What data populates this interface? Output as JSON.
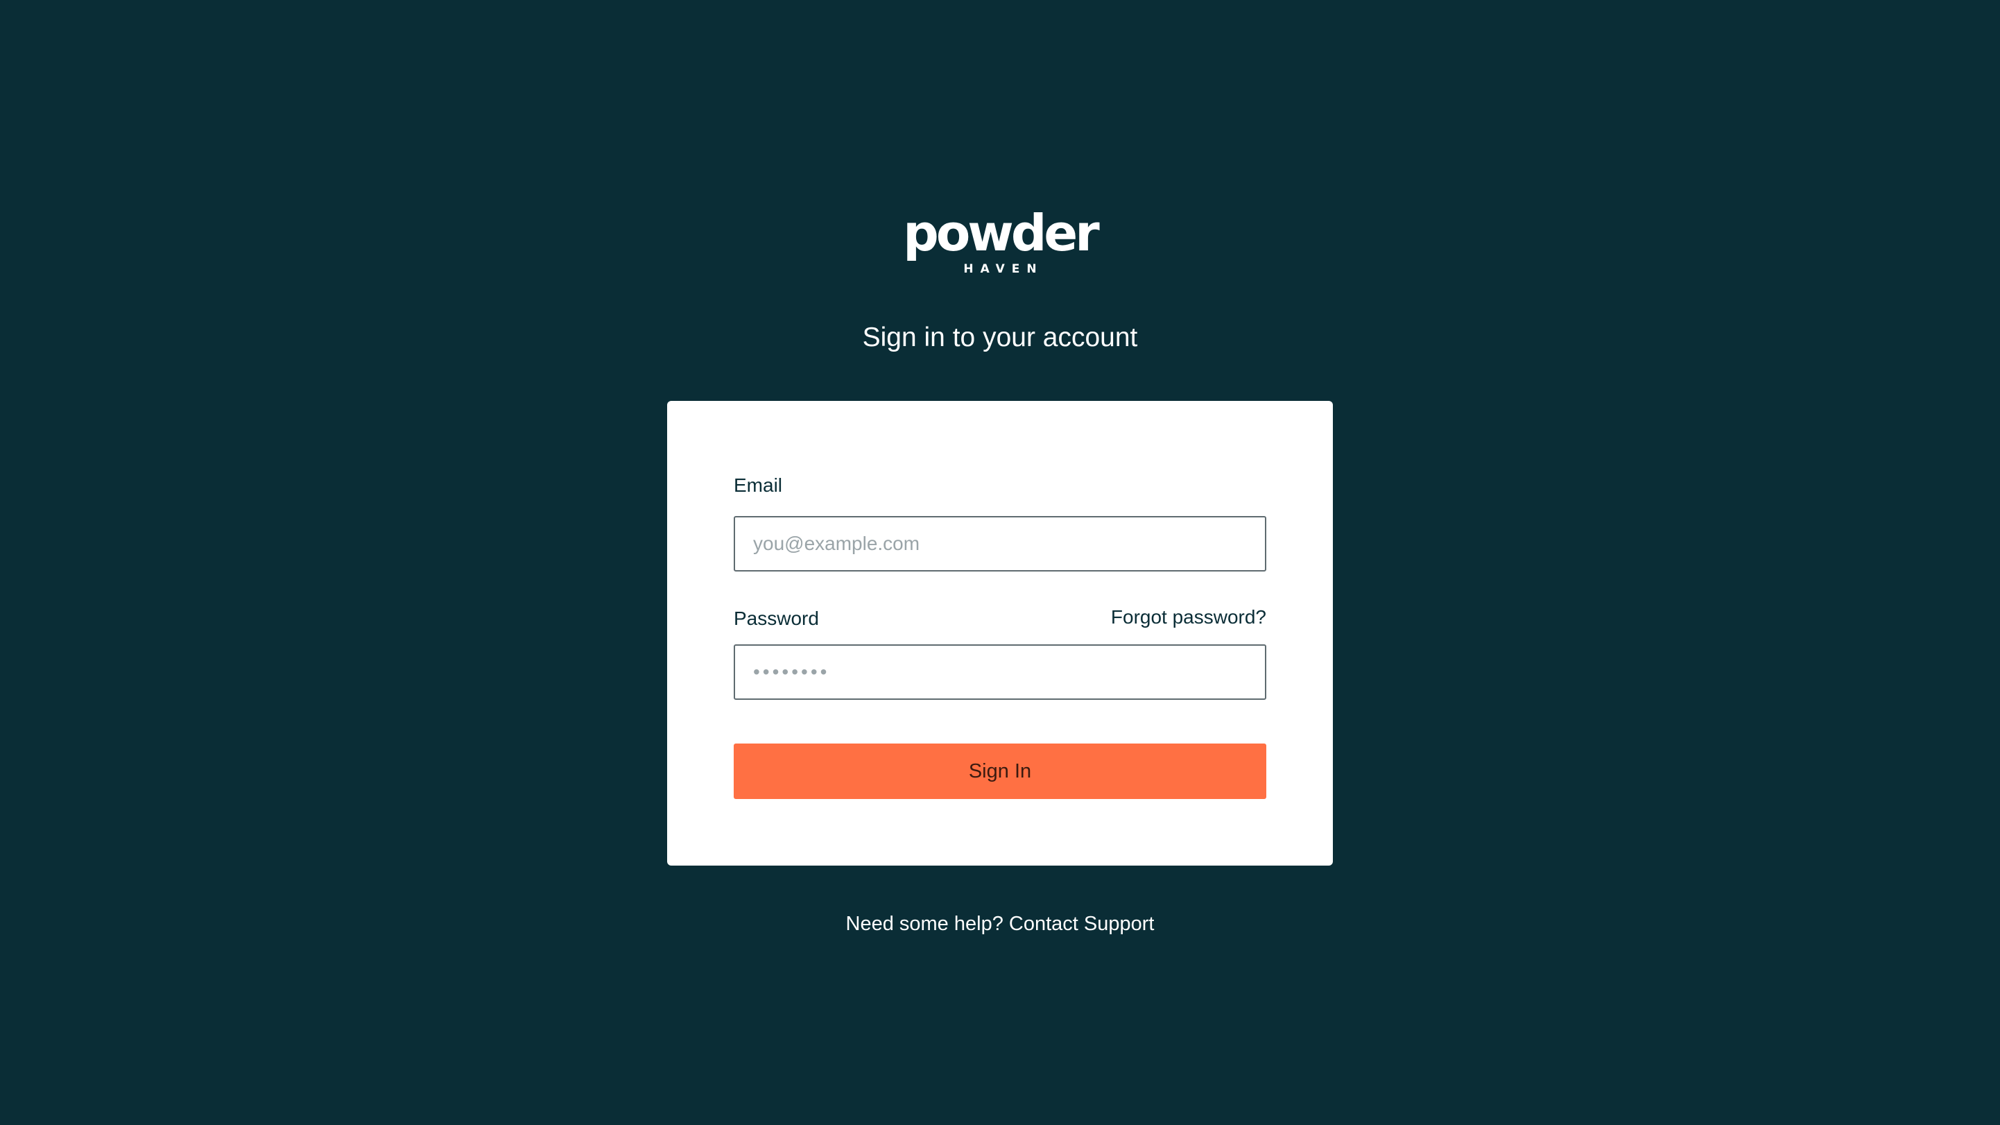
{
  "brand": {
    "wordmark": "powder",
    "subtitle": "HAVEN"
  },
  "page": {
    "heading": "Sign in to your account"
  },
  "form": {
    "email_label": "Email",
    "email_placeholder": "you@example.com",
    "password_label": "Password",
    "forgot_label": "Forgot password?",
    "password_placeholder": "••••••••",
    "submit_label": "Sign In"
  },
  "help": {
    "prompt": "Need some help?",
    "link_label": "Contact Support"
  },
  "colors": {
    "background": "#0a2d36",
    "card": "#ffffff",
    "text_dark": "#0a2d36",
    "text_light": "#ffffff",
    "accent": "#ff7043",
    "button_text": "#3a1a10",
    "input_border": "#5f6b70",
    "placeholder": "#9aa4a8"
  }
}
